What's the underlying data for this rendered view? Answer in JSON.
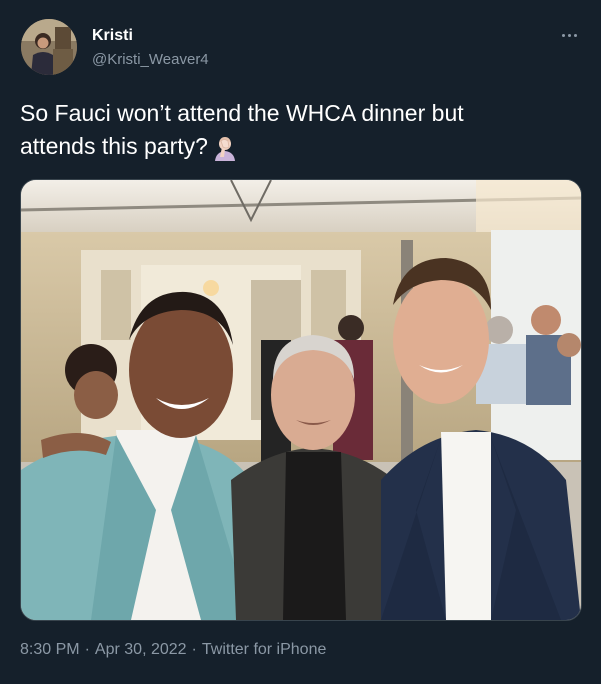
{
  "author": {
    "display_name": "Kristi",
    "handle": "@Kristi_Weaver4",
    "avatar_icon": "profile-photo"
  },
  "tweet": {
    "text_line1": "So Fauci won’t attend the WHCA dinner but",
    "text_line2": "attends this party?",
    "emoji_icon": "facepalm-emoji"
  },
  "media": {
    "alt": "Group selfie of three men at an indoor party under a white tent"
  },
  "footer": {
    "time": "8:30 PM",
    "separator": "·",
    "date": "Apr 30, 2022",
    "source": "Twitter for iPhone"
  },
  "colors": {
    "background": "#15202b",
    "text_primary": "#ffffff",
    "text_secondary": "#8b98a5",
    "border": "#38444d"
  }
}
